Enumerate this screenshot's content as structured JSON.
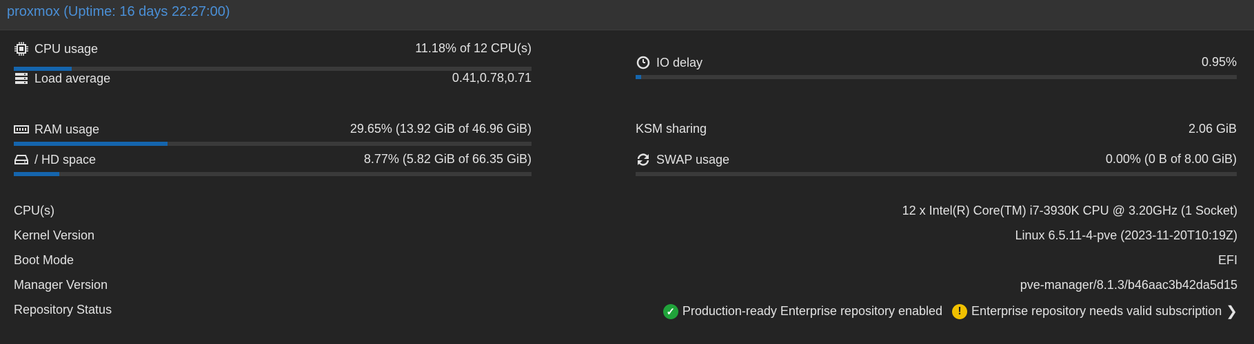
{
  "header": {
    "title": "proxmox (Uptime: 16 days 22:27:00)"
  },
  "metrics": {
    "cpu": {
      "label": "CPU usage",
      "value": "11.18% of 12 CPU(s)",
      "fraction": 0.1118,
      "icon": "cpu-icon"
    },
    "load": {
      "label": "Load average",
      "value": "0.41,0.78,0.71",
      "icon": "server-icon"
    },
    "io": {
      "label": "IO delay",
      "value": "0.95%",
      "fraction": 0.0095,
      "icon": "clock-icon"
    },
    "ram": {
      "label": "RAM usage",
      "value": "29.65% (13.92 GiB of 46.96 GiB)",
      "fraction": 0.2965,
      "icon": "memory-icon"
    },
    "ksm": {
      "label": "KSM sharing",
      "value": "2.06 GiB"
    },
    "hd": {
      "label": "/ HD space",
      "value": "8.77% (5.82 GiB of 66.35 GiB)",
      "fraction": 0.0877,
      "icon": "hdd-icon"
    },
    "swap": {
      "label": "SWAP usage",
      "value": "0.00% (0 B of 8.00 GiB)",
      "fraction": 0.0,
      "icon": "refresh-icon"
    }
  },
  "info": {
    "cpus": {
      "label": "CPU(s)",
      "value": "12 x Intel(R) Core(TM) i7-3930K CPU @ 3.20GHz (1 Socket)"
    },
    "kernel": {
      "label": "Kernel Version",
      "value": "Linux 6.5.11-4-pve (2023-11-20T10:19Z)"
    },
    "boot": {
      "label": "Boot Mode",
      "value": "EFI"
    },
    "manager": {
      "label": "Manager Version",
      "value": "pve-manager/8.1.3/b46aac3b42da5d15"
    },
    "repo": {
      "label": "Repository Status",
      "ok_text": "Production-ready Enterprise repository enabled",
      "warn_text": "Enterprise repository needs valid subscription"
    }
  },
  "colors": {
    "accent": "#1565ad",
    "title": "#4a8fd6",
    "ok": "#20a33a",
    "warn": "#f0c000"
  }
}
